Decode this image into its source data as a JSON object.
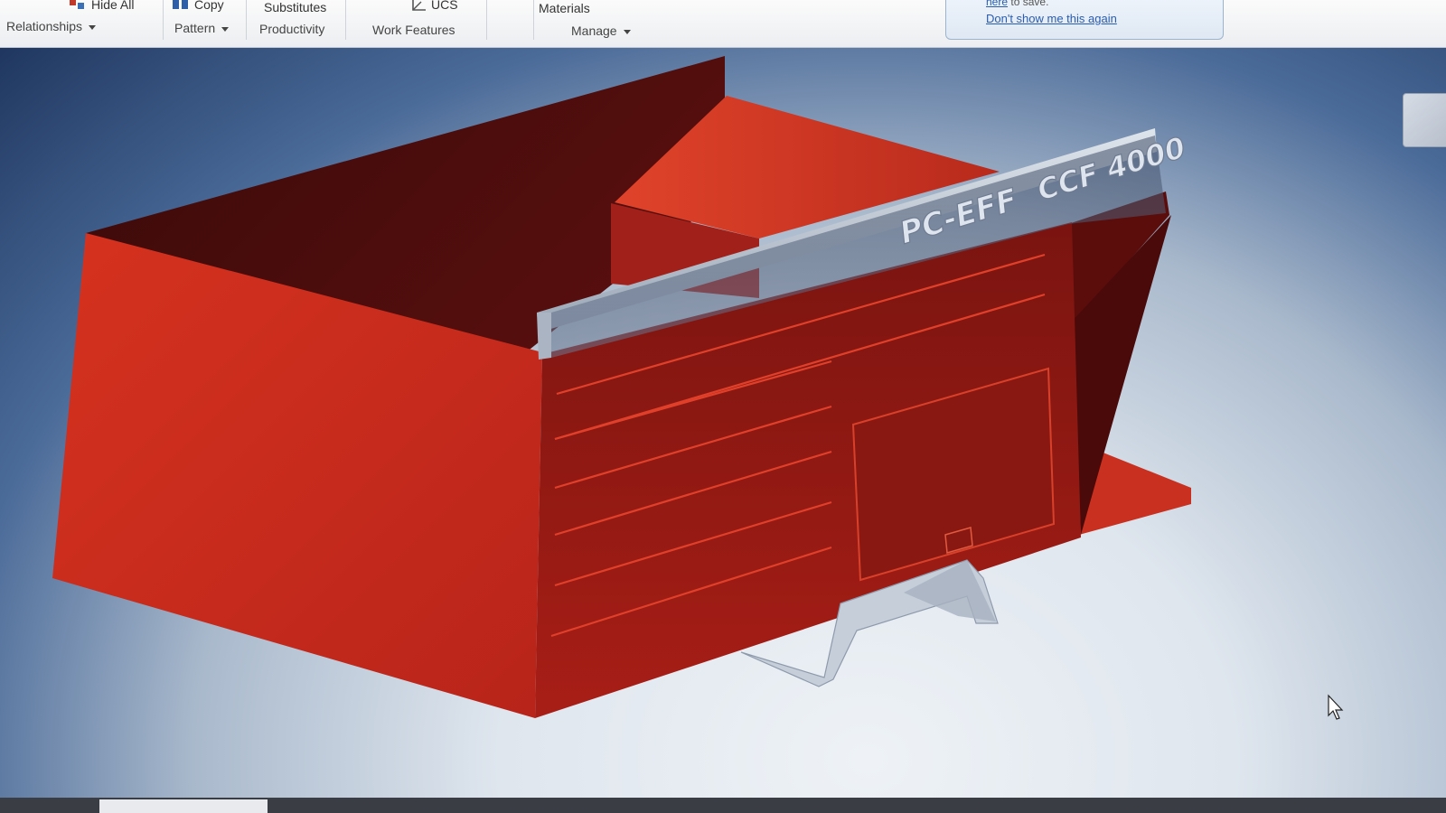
{
  "ribbon": {
    "hide_all": "Hide All",
    "copy": "Copy",
    "substitutes": "Substitutes",
    "ucs": "UCS",
    "materials": "Materials",
    "panels": {
      "relationships": "Relationships",
      "pattern": "Pattern",
      "productivity": "Productivity",
      "work_features": "Work Features",
      "manage": "Manage"
    }
  },
  "notification": {
    "save_link": "here",
    "save_suffix": "to save.",
    "dont_show": "Don't show me this again"
  },
  "model": {
    "sign_left": "PC-EFF",
    "sign_right": "CCF 4000",
    "colors": {
      "body": "#c8291f",
      "body_dark": "#5a0d0b",
      "sign": "#b9c3d1"
    }
  },
  "icons": [
    "hide-all-icon",
    "copy-icon",
    "ucs-icon",
    "view-cube-icon",
    "mouse-cursor-icon"
  ]
}
